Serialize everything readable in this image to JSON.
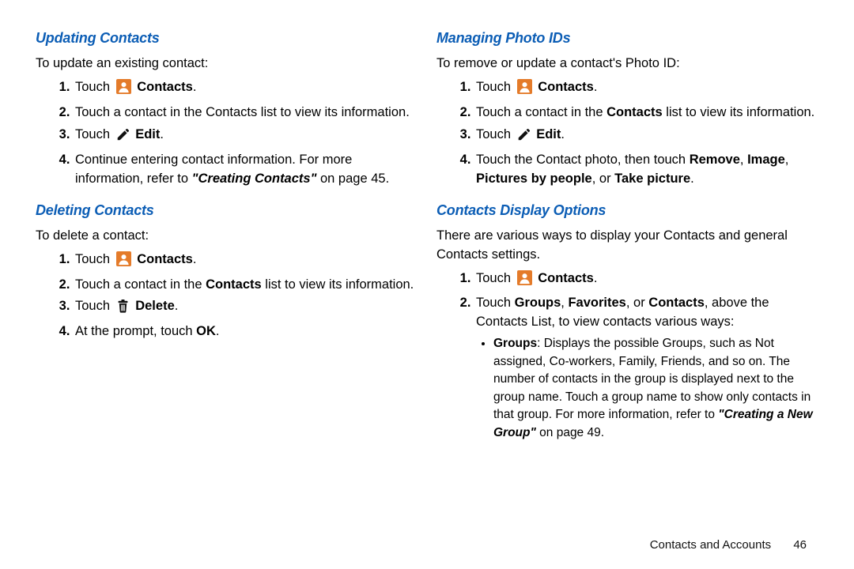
{
  "left": {
    "sec1": {
      "heading": "Updating Contacts",
      "intro": "To update an existing contact:",
      "s1a": "Touch ",
      "s1b": "Contacts",
      "s1c": ".",
      "s2": "Touch a contact in the Contacts list to view its information.",
      "s3a": "Touch ",
      "s3b": "Edit",
      "s3c": ".",
      "s4a": "Continue entering contact information. For more information, refer to ",
      "s4b": "\"Creating Contacts\"",
      "s4c": " on page 45."
    },
    "sec2": {
      "heading": "Deleting Contacts",
      "intro": "To delete a contact:",
      "s1a": "Touch ",
      "s1b": "Contacts",
      "s1c": ".",
      "s2a": "Touch a contact in the ",
      "s2b": "Contacts",
      "s2c": " list to view its information.",
      "s3a": "Touch ",
      "s3b": "Delete",
      "s3c": ".",
      "s4a": "At the prompt, touch ",
      "s4b": "OK",
      "s4c": "."
    }
  },
  "right": {
    "sec1": {
      "heading": "Managing Photo IDs",
      "intro": "To remove or update a contact's Photo ID:",
      "s1a": "Touch ",
      "s1b": "Contacts",
      "s1c": ".",
      "s2a": "Touch a contact in the ",
      "s2b": "Contacts",
      "s2c": " list to view its information.",
      "s3a": "Touch ",
      "s3b": "Edit",
      "s3c": ".",
      "s4a": "Touch the Contact photo, then touch ",
      "s4b": "Remove",
      "s4c": ", ",
      "s4d": "Image",
      "s4e": ", ",
      "s4f": "Pictures by people",
      "s4g": ", or ",
      "s4h": "Take picture",
      "s4i": "."
    },
    "sec2": {
      "heading": "Contacts Display Options",
      "intro": "There are various ways to display your Contacts and general Contacts settings.",
      "s1a": "Touch ",
      "s1b": "Contacts",
      "s1c": ".",
      "s2a": "Touch ",
      "s2b": "Groups",
      "s2c": ", ",
      "s2d": "Favorites",
      "s2e": ", or ",
      "s2f": "Contacts",
      "s2g": ", above the Contacts List, to view contacts various ways:",
      "b1a": "Groups",
      "b1b": ": Displays the possible Groups, such as Not assigned, Co-workers, Family, Friends, and so on. The number of contacts in the group is displayed next to the group name. Touch a group name to show only contacts in that group. For more information, refer to ",
      "b1c": "\"Creating a New Group\"",
      "b1d": " on page 49."
    }
  },
  "footer": {
    "section": "Contacts and Accounts",
    "page": "46"
  }
}
